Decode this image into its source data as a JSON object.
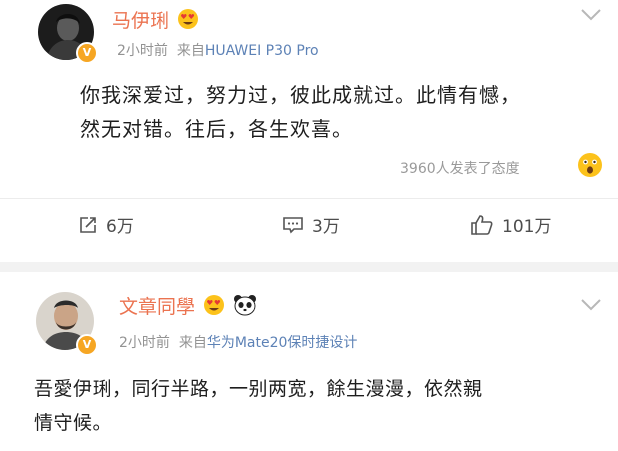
{
  "posts": [
    {
      "author": "马伊琍",
      "time": "2小时前",
      "source_prefix": "来自",
      "source": "HUAWEI P30 Pro",
      "text_line1": "你我深爱过，努力过，彼此成就过。此情有憾，",
      "text_line2": "然无对错。往后，各生欢喜。",
      "attitude_text": "3960人发表了态度",
      "repost_count": "6万",
      "comment_count": "3万",
      "like_count": "101万"
    },
    {
      "author": "文章同學",
      "time": "2小时前",
      "source_prefix": "来自",
      "source": "华为Mate20保时捷设计",
      "text_line1": "吾愛伊琍，同行半路，一别两宽，餘生漫漫，依然親",
      "text_line2": "情守候。"
    }
  ],
  "colors": {
    "name": "#eb7350",
    "source_link": "#5d82b6",
    "meta": "#939393",
    "verified": "#f6a623"
  },
  "icons": {
    "verified": "verified-badge-icon",
    "chevron": "chevron-down-icon",
    "repost": "repost-icon",
    "comment": "comment-icon",
    "like": "thumbs-up-icon",
    "attitude": "surprised-face-icon",
    "heart_eyes": "heart-eyes-emoji-icon",
    "panda": "panda-emoji-icon"
  }
}
